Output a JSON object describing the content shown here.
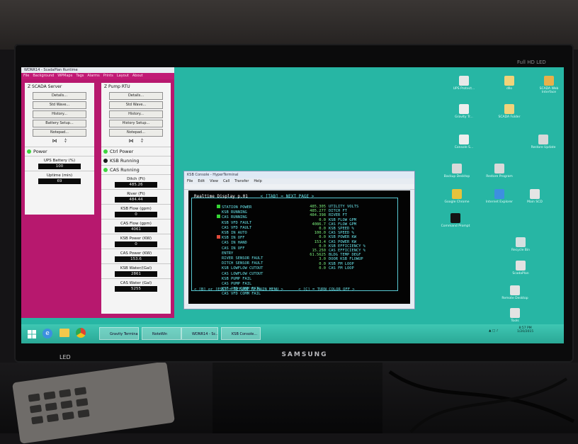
{
  "photo": {
    "monitor_brand": "SAMSUNG",
    "bezel_text": "Full HD LED",
    "led_label": "LED"
  },
  "scada_window": {
    "title": "WDNR14 - ScadaPlan Runtime",
    "menu": [
      "File",
      "Background",
      "WPMaps",
      "Tags",
      "Alarms",
      "Prints",
      "Layout",
      "About"
    ],
    "left_panel": {
      "title": "Z SCADA Server",
      "buttons": [
        "Details...",
        "Std Wave...",
        "History...",
        "Battery Setup...",
        "Notepad..."
      ],
      "indicators": [
        {
          "label": "Power",
          "color": "#3fd43f"
        }
      ],
      "meters": [
        {
          "label": "UPS Battery (%)",
          "value": "100"
        },
        {
          "label": "Uptime (min)",
          "value": "69"
        }
      ]
    },
    "right_panel": {
      "title": "Z Pump RTU",
      "buttons": [
        "Details...",
        "Std Wave...",
        "History...",
        "History Setup...",
        "Notepad..."
      ],
      "indicators": [
        {
          "label": "Ctrl Power",
          "color": "#3fd43f"
        },
        {
          "label": "KSB Running",
          "color": "#1a1a1a"
        },
        {
          "label": "CAS Running",
          "color": "#3fd43f"
        }
      ],
      "meters": [
        {
          "label": "Ditch (Ft)",
          "value": "485.26"
        },
        {
          "label": "River (Ft)",
          "value": "484.44"
        },
        {
          "label": "KSB Flow (gpm)",
          "value": "0"
        },
        {
          "label": "CAS Flow (gpm)",
          "value": "4061"
        },
        {
          "label": "KSB Power (KW)",
          "value": "0"
        },
        {
          "label": "CAS Power (KW)",
          "value": "153.6"
        },
        {
          "label": "KSB Water/(Gal)",
          "value": "2861"
        },
        {
          "label": "CAS Water (Gal)",
          "value": "5255"
        }
      ]
    }
  },
  "terminal_window": {
    "title": "KSB Console - HyperTerminal",
    "menu": [
      "File",
      "Edit",
      "View",
      "Call",
      "Transfer",
      "Help"
    ],
    "header": [
      "Realtime Display   p.01",
      "< [TAB] = NEXT PAGE >"
    ],
    "left_rows": [
      {
        "text": "STATION POWER",
        "marker": "#35d435"
      },
      {
        "text": "KSB RUNNING",
        "marker": ""
      },
      {
        "text": "CAS RUNNING",
        "marker": "#35d435"
      },
      {
        "text": "KSB VFD FAULT",
        "marker": ""
      },
      {
        "text": "CAS VFD FAULT",
        "marker": ""
      },
      {
        "text": "KSB IN AUTO",
        "marker": ""
      },
      {
        "text": "KSB IN OFF",
        "marker": "#e04a3a"
      },
      {
        "text": "CAS IN HAND",
        "marker": ""
      },
      {
        "text": "CAS IN OFF",
        "marker": ""
      },
      {
        "text": "ENTRY",
        "marker": ""
      },
      {
        "text": "RIVER SENSOR FAULT",
        "marker": ""
      },
      {
        "text": "DITCH SENSOR FAULT",
        "marker": ""
      },
      {
        "text": "KSB LOWFLOW CUTOUT",
        "marker": ""
      },
      {
        "text": "CAS LOWFLOW CUTOUT",
        "marker": ""
      },
      {
        "text": "KSB PUMP FAIL",
        "marker": ""
      },
      {
        "text": "CAS PUMP FAIL",
        "marker": ""
      },
      {
        "text": "KSB VFD COMM FAIL",
        "marker": ""
      },
      {
        "text": "CAS VFD COMM FAIL",
        "marker": ""
      }
    ],
    "right_rows": [
      {
        "value": "485.305",
        "label": "UTILITY VOLTS"
      },
      {
        "value": "485.277",
        "label": "DITCH FT"
      },
      {
        "value": "484.398",
        "label": "RIVER FT"
      },
      {
        "value": "0.0",
        "label": "KSB FLOW GPM"
      },
      {
        "value": "4086.7",
        "label": "CAS FLOW GPM"
      },
      {
        "value": "0.0",
        "label": "KSB SPEED %"
      },
      {
        "value": "100.0",
        "label": "CAS SPEED %"
      },
      {
        "value": "0.0",
        "label": "KSB POWER KW"
      },
      {
        "value": "153.4",
        "label": "CAS POWER KW"
      },
      {
        "value": "0.0",
        "label": "KSB EFFICIENCY %"
      },
      {
        "value": "15.250",
        "label": "CAS EFFICIENCY %"
      },
      {
        "value": "61.5625",
        "label": "BLDG TEMP DEGF"
      },
      {
        "value": "3.0",
        "label": "DOOR KSB FLOWUP"
      },
      {
        "value": "0.0",
        "label": "KSB FM LOOP"
      },
      {
        "value": "0.0",
        "label": "CAS FM LOOP"
      }
    ],
    "footer": [
      "< [B] or [ESC] = RETURN TO MAIN MENU >",
      "< [C] = TURN COLOR OFF >"
    ]
  },
  "desktop_icons": [
    {
      "label": "UPS Protect...",
      "color": "#e8e8e8"
    },
    {
      "label": "dllo",
      "color": "#f1d37a"
    },
    {
      "label": "SCADA Web Interface",
      "color": "#e9b04a"
    },
    {
      "label": "Gravity Tr...",
      "color": "#eeeeee"
    },
    {
      "label": "SCADA Folder",
      "color": "#f1d37a"
    },
    {
      "label": "Console S...",
      "color": "#eeeeee"
    },
    {
      "label": "Restore Update",
      "color": "#d8d8d8"
    },
    {
      "label": "Backup Desktop",
      "color": "#d9d9d9"
    },
    {
      "label": "Restore Program",
      "color": "#d9d9d9"
    },
    {
      "label": "Google Chrome",
      "color": "#e6c33b"
    },
    {
      "label": "Internet Explorer",
      "color": "#3d8fe0"
    },
    {
      "label": "Main SCD",
      "color": "#e5e5e5"
    },
    {
      "label": "Command Prompt",
      "color": "#141414"
    },
    {
      "label": "Recycle Bin",
      "color": "#d5e0e0"
    },
    {
      "label": "ScadaPlan",
      "color": "#e2e2e2"
    },
    {
      "label": "Remote Desktop",
      "color": "#e3e3e3"
    },
    {
      "label": "Tools",
      "color": "#e3e3e3"
    }
  ],
  "taskbar": {
    "buttons": [
      "Gravity Terminal",
      "NoteWin",
      "WDNR14 - Sc...",
      "KSB Console..."
    ],
    "clock_time": "8:57 PM",
    "clock_date": "1/20/2015"
  }
}
